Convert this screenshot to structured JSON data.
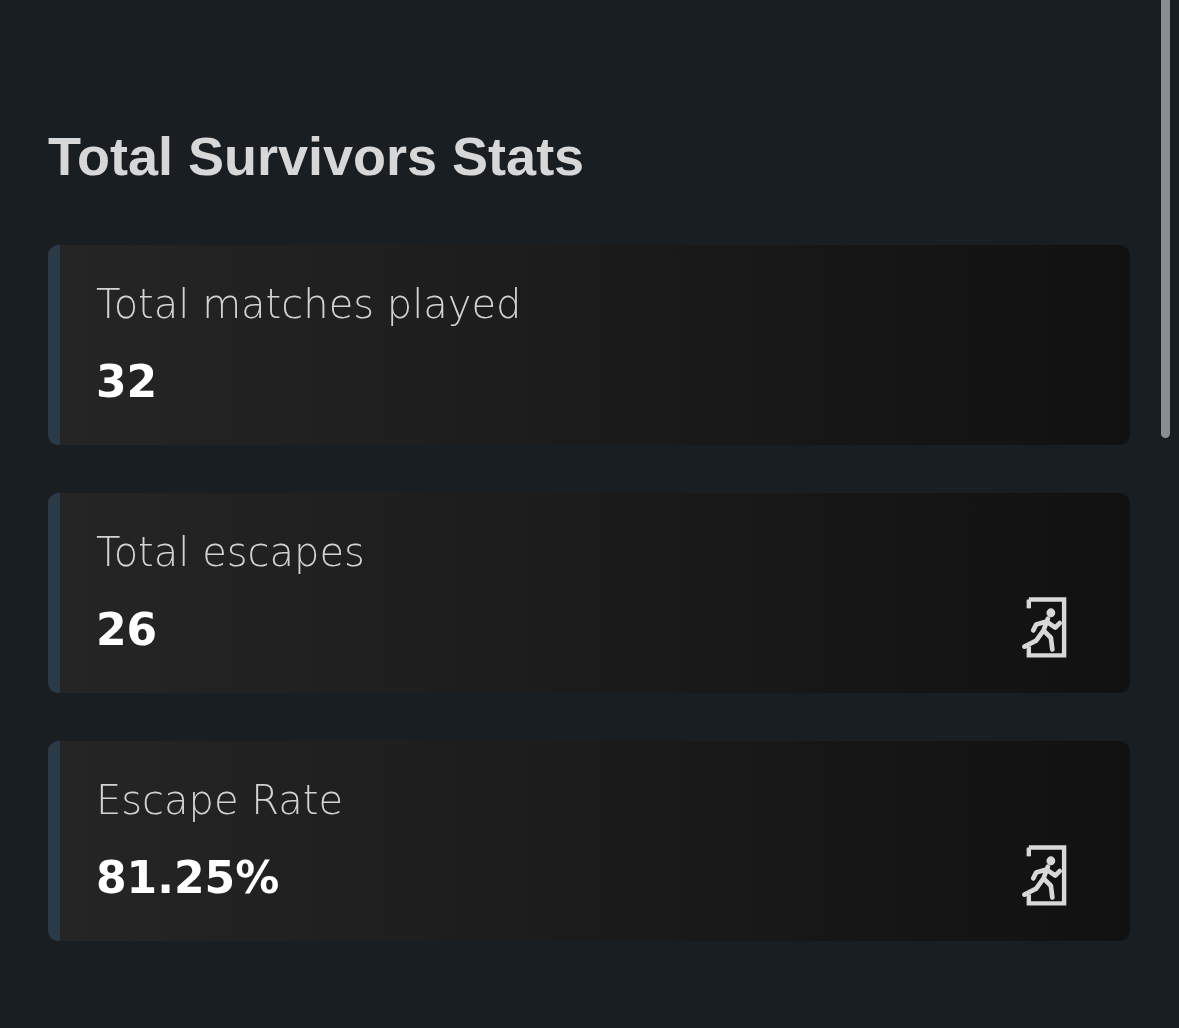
{
  "title": "Total Survivors Stats",
  "cards": [
    {
      "label": "Total matches played",
      "value": "32",
      "kind": "plain"
    },
    {
      "label": "Total escapes",
      "value": "26",
      "kind": "escape"
    },
    {
      "label": "Escape Rate",
      "value": "81.25%",
      "kind": "escape"
    }
  ]
}
